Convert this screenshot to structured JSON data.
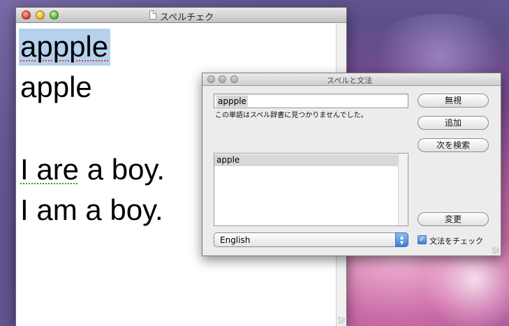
{
  "document_window": {
    "title": "スペルチェク",
    "lines": {
      "misspelled_word": "appple",
      "line2": "apple",
      "line4_error": "I are",
      "line4_rest": " a boy.",
      "line5": "I am a boy."
    }
  },
  "panel": {
    "title": "スペルと文法",
    "word_value": "appple",
    "message": "この単語はスペル辞書に見つかりませんでした。",
    "suggestions": [
      "apple"
    ],
    "language": "English",
    "buttons": {
      "ignore": "無視",
      "learn": "追加",
      "find_next": "次を検索",
      "change": "変更"
    },
    "check_grammar_label": "文法をチェック",
    "check_grammar_checked": true
  },
  "colors": {
    "selection": "#b5d1ed",
    "spelling_underline": "#e23a3a",
    "grammar_underline": "#2d9a2d"
  }
}
